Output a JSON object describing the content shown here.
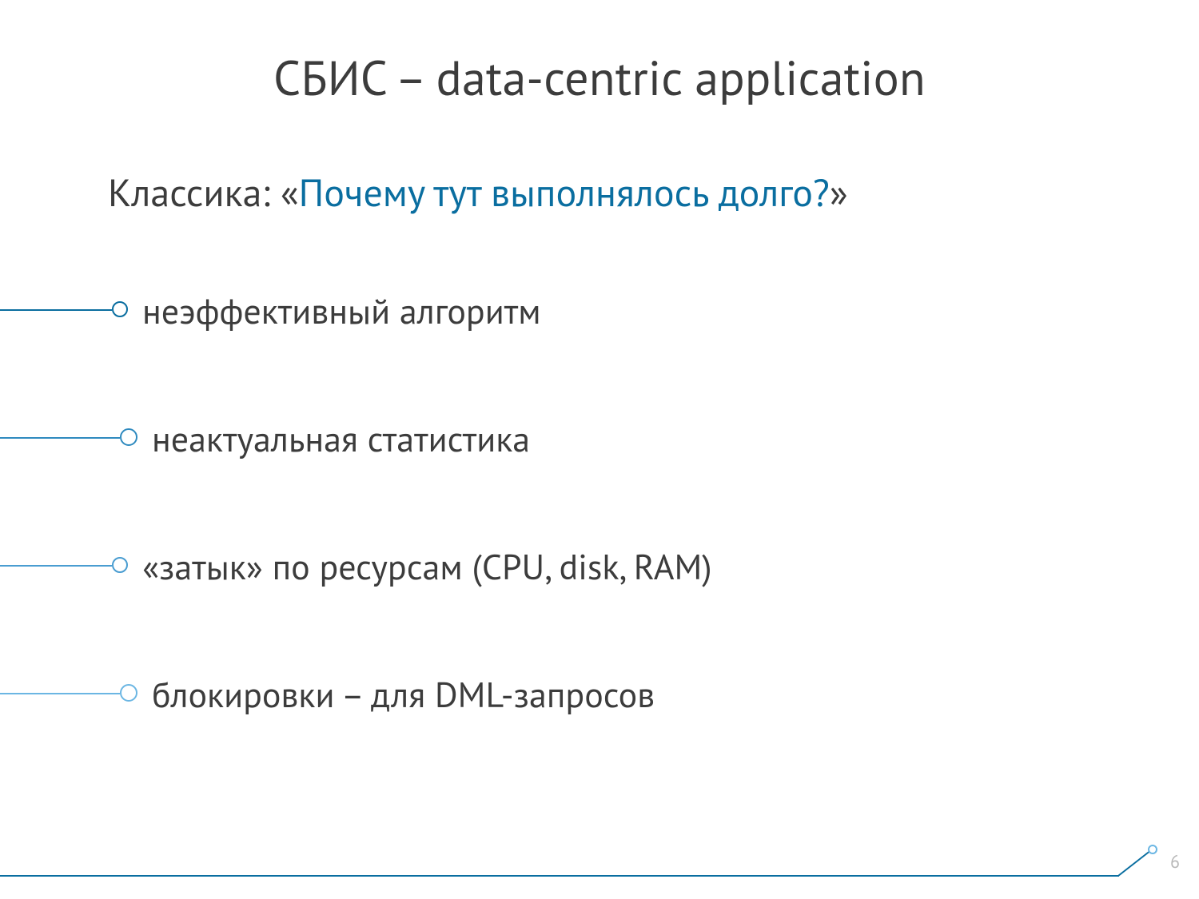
{
  "title": "СБИС – data-centric application",
  "subtitle_prefix": "Классика: «",
  "subtitle_accent": "Почему тут выполнялось долго?",
  "subtitle_suffix": "»",
  "bullets": [
    "неэффективный алгоритм",
    "неактуальная статистика",
    "«затык» по ресурсам (CPU, disk, RAM)",
    "блокировки – для DML-запросов"
  ],
  "page_number": "6",
  "colors": {
    "text": "#3c3c3c",
    "accent": "#0a6ea0",
    "bullet_tints": [
      "#0a6ea0",
      "#2f8abf",
      "#4a9dd1",
      "#6bb6e3"
    ],
    "page_number": "#b8b8b8"
  }
}
